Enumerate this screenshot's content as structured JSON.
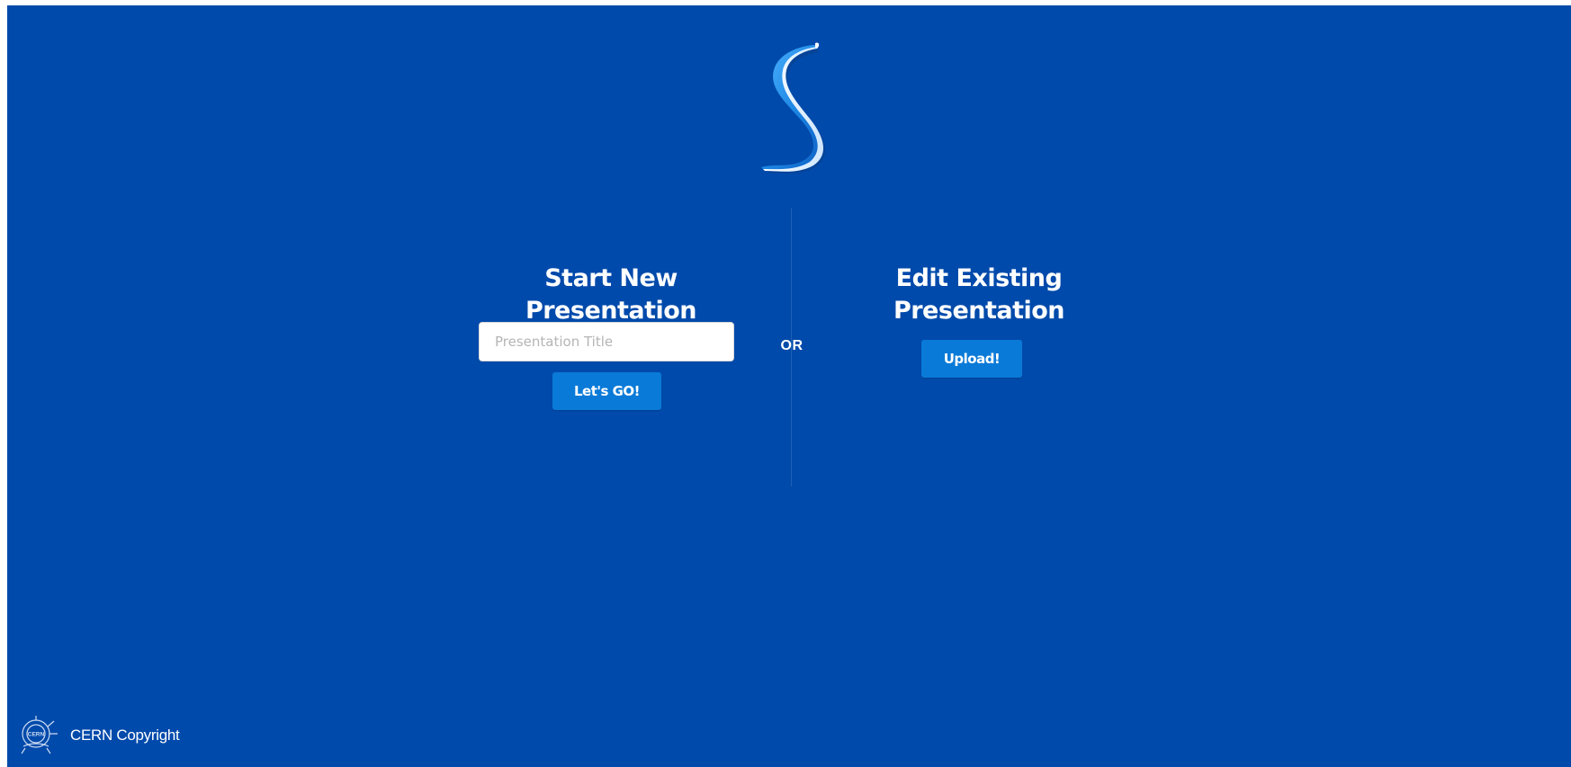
{
  "brand": {
    "logo_icon": "s-ribbon-logo-icon",
    "background_color": "#004aab",
    "button_color": "#0a7ad8"
  },
  "new_presentation": {
    "title": "Start New Presentation",
    "input_placeholder": "Presentation Title",
    "input_value": "",
    "button_label": "Let's GO!"
  },
  "separator": {
    "label": "OR"
  },
  "existing_presentation": {
    "title": "Edit Existing Presentation",
    "button_label": "Upload!"
  },
  "footer": {
    "logo_icon": "cern-logo-icon",
    "copyright": "CERN Copyright"
  }
}
